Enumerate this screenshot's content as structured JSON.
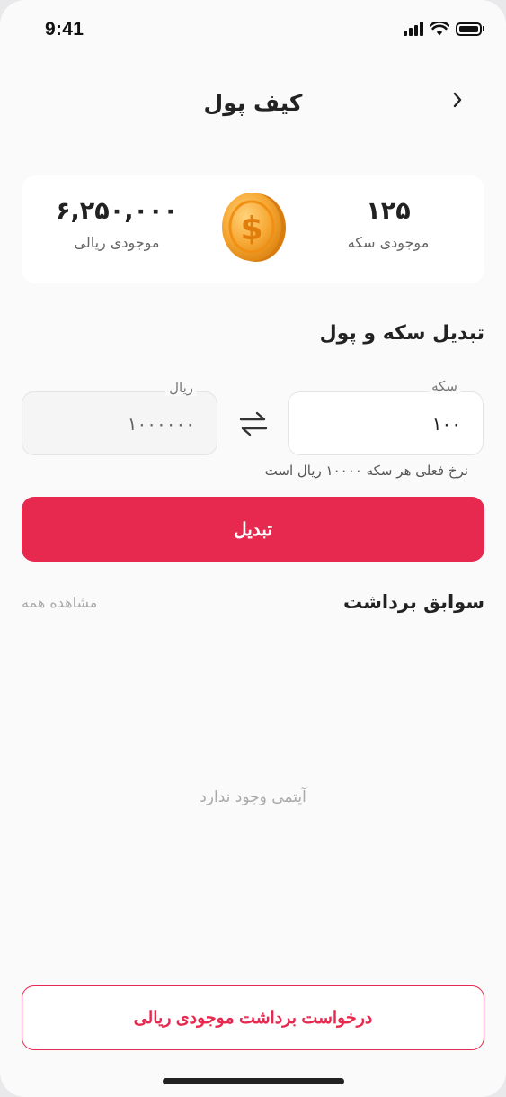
{
  "status_bar": {
    "time": "9:41"
  },
  "header": {
    "title": "کیف پول",
    "back_icon": "chevron-right-icon"
  },
  "balance": {
    "coin_value": "۱۲۵",
    "coin_label": "موجودی سکه",
    "rial_value": "۶,۲۵۰,۰۰۰",
    "rial_label": "موجودی ریالی",
    "coin_icon": "dollar-coin-icon"
  },
  "converter": {
    "title": "تبدیل سکه و پول",
    "coin_field_label": "سکه",
    "coin_field_value": "۱۰۰",
    "rial_field_label": "ریال",
    "rial_field_value": "۱۰۰۰۰۰۰",
    "swap_icon": "swap-arrows-icon",
    "rate_text": "نرخ فعلی هر سکه ۱۰۰۰۰ ریال است",
    "convert_label": "تبدیل"
  },
  "history": {
    "title": "سوابق برداشت",
    "see_all_label": "مشاهده همه",
    "empty_text": "آیتمی وجود ندارد"
  },
  "withdraw": {
    "label": "درخواست برداشت موجودی ریالی"
  },
  "colors": {
    "accent": "#e8294f",
    "background": "#fafafa",
    "coin": "#f5a623"
  }
}
